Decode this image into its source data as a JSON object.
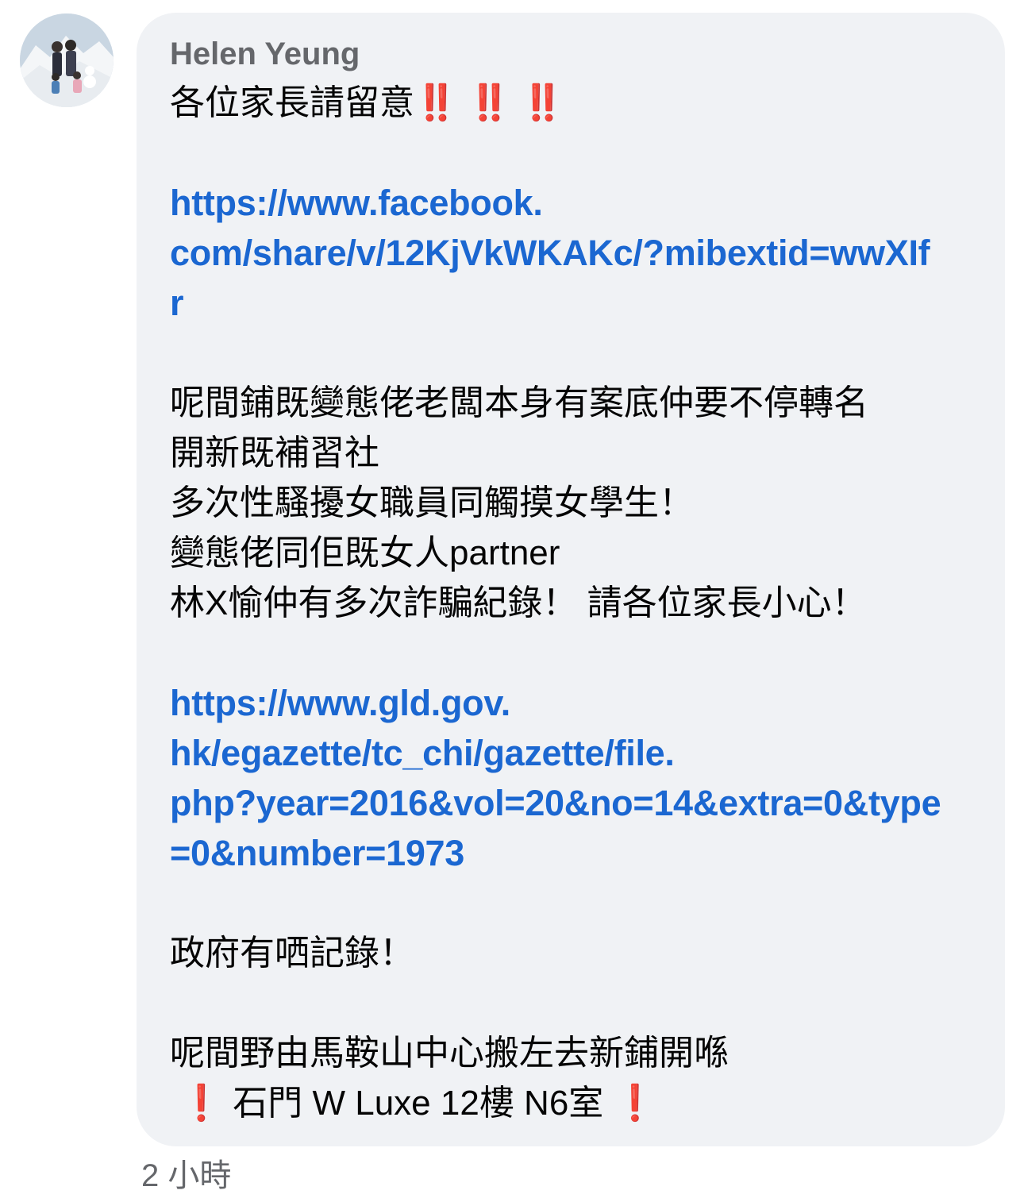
{
  "comment": {
    "author": "Helen Yeung",
    "title_text": "各位家長請留意",
    "title_emoji": "‼️ ‼️ ‼️",
    "link1_lines": [
      "https://www.facebook.",
      "com/share/v/12KjVkWKAKc/?mibextid=wwXIf",
      "r"
    ],
    "paragraph_lines": [
      "呢間鋪既變態佬老闆本身有案底仲要不停轉名",
      "開新既補習社",
      "多次性騷擾女職員同觸摸女學生！",
      "變態佬同佢既女人partner",
      "林X愉仲有多次詐騙紀錄！ 請各位家長小心！"
    ],
    "link2_lines": [
      "https://www.gld.gov.",
      "hk/egazette/tc_chi/gazette/file.",
      "php?year=2016&vol=20&no=14&extra=0&type",
      "=0&number=1973"
    ],
    "govt_record": "政府有哂記錄！",
    "move_text": "呢間野由馬鞍山中心搬左去新鋪開喺",
    "address_emoji_left": "❗",
    "address_text": "石門 W Luxe 12樓 N6室",
    "address_emoji_right": "❗",
    "timestamp": "2 小時"
  },
  "colors": {
    "bubble": "#f0f2f5",
    "author": "#65676b",
    "text": "#050505",
    "link": "#1b67d1",
    "emoji_red": "#dd1f2b"
  }
}
